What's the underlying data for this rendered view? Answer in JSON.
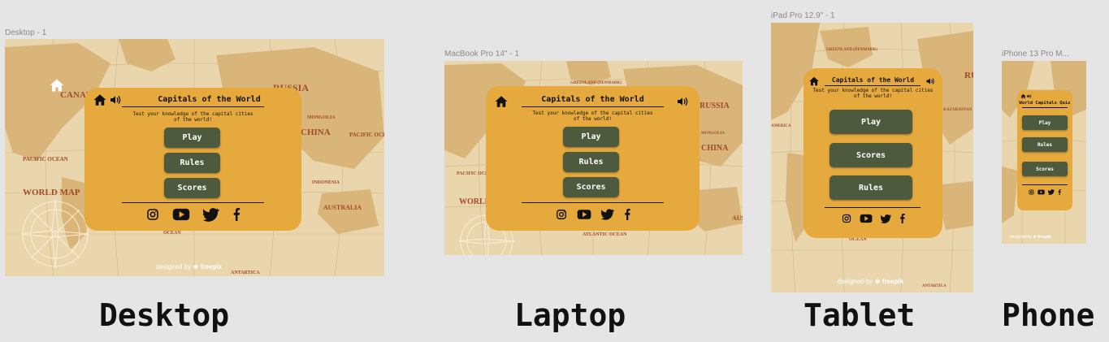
{
  "frames": {
    "desktop": {
      "label": "Desktop - 1"
    },
    "laptop": {
      "label": "MacBook Pro 14\" - 1"
    },
    "tablet": {
      "label": "iPad Pro 12.9\" - 1"
    },
    "phone": {
      "label": "iPhone 13 Pro M..."
    }
  },
  "quiz": {
    "title": "Capitals of the World",
    "phone_title": "World Capitals Quiz",
    "subtitle_line1": "Test your knowledge of the capital cities",
    "subtitle_line2": "of the world!",
    "play": "Play",
    "rules": "Rules",
    "scores": "Scores"
  },
  "credit": {
    "prefix": "designed by",
    "brand": "freepik"
  },
  "map_labels": {
    "canada": "CANADA",
    "russia": "RUSSIA",
    "china": "CHINA",
    "pacific_ocean": "PACIFIC OCEAN",
    "world_map": "WORLD MAP",
    "australia": "AUSTRALIA",
    "indonesia": "INDONESIA",
    "greenland": "GREENLAND (DENMARK)",
    "mongolia": "MONGOLIA",
    "kazakhstan": "KAZAKHSTAN",
    "atlantic_ocean": "ATLANTIC OCEAN",
    "antartica": "ANTARTICA",
    "america": "AMERICA",
    "ocean": "OCEAN"
  },
  "device_captions": {
    "desktop": "Desktop",
    "laptop": "Laptop",
    "tablet": "Tablet",
    "phone": "Phone"
  },
  "icons": [
    "home-icon",
    "volume-icon",
    "instagram-icon",
    "youtube-icon",
    "twitter-icon",
    "facebook-icon"
  ],
  "colors": {
    "canvas": "#e5e5e5",
    "map_bg": "#ead6ad",
    "card": "#e5a93d",
    "button": "#4d5a3e",
    "button_text": "#ffffff"
  }
}
